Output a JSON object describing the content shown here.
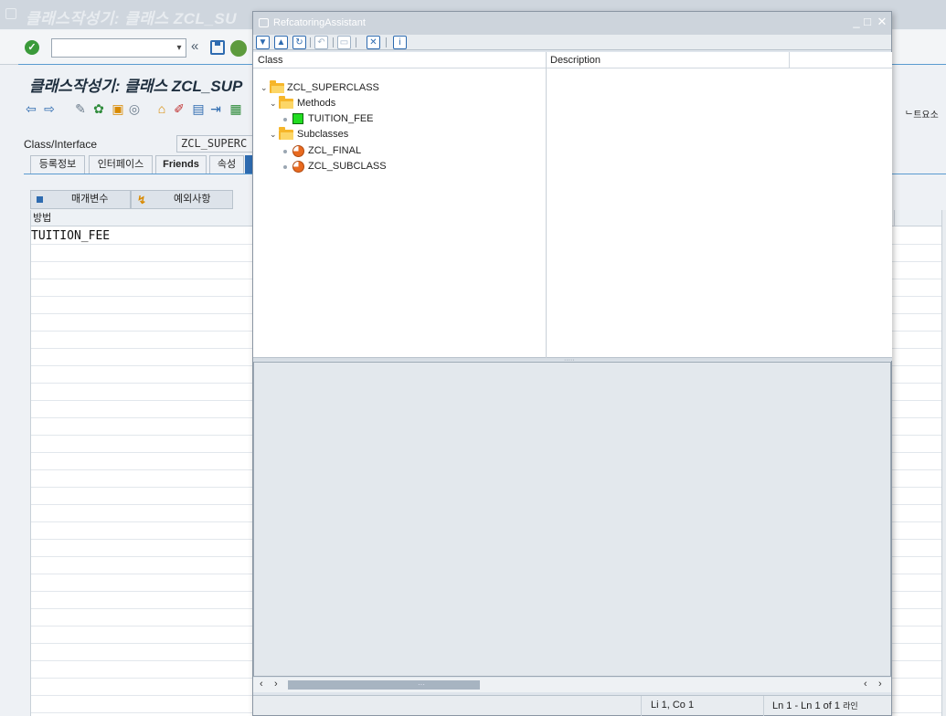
{
  "main": {
    "window_title": "클래스작성기: 클래스 ZCL_SU",
    "screen_title": "클래스작성기: 클래스 ZCL_SUP",
    "elements_label": "ᄂ트요소",
    "class_interface_label": "Class/Interface",
    "class_interface_value": "ZCL_SUPERC",
    "tabs": [
      {
        "label": "등록정보"
      },
      {
        "label": "인터페이스"
      },
      {
        "label": "Friends"
      },
      {
        "label": "속성"
      }
    ],
    "params_label": "매개변수",
    "exceptions_label": "예외사항",
    "grid_header": "방법",
    "rows": [
      "TUITION_FEE"
    ]
  },
  "popup": {
    "title": "RefcatoringAssistant",
    "tree": {
      "col_class": "Class",
      "col_description": "Description",
      "root": "ZCL_SUPERCLASS",
      "methods_folder": "Methods",
      "method": "TUITION_FEE",
      "subclasses_folder": "Subclasses",
      "subclasses": [
        "ZCL_FINAL",
        "ZCL_SUBCLASS"
      ]
    },
    "status": {
      "position": "Li 1, Co 1",
      "lines": "Ln 1 - Ln 1 of 1",
      "lines_suffix": "라인"
    }
  },
  "colors": {
    "accent": "#2e6bb0",
    "folder": "#f6b62a",
    "method_icon": "#22dd22",
    "subclass_icon": "#e86a20"
  },
  "icons": {
    "main_toolbar": [
      "check-icon",
      "collapse-icon",
      "save-icon",
      "back-icon"
    ],
    "popup_toolbar": [
      "expand-all-icon",
      "collapse-all-icon",
      "refresh-icon",
      "undo-icon",
      "save-icon",
      "close-icon",
      "info-icon"
    ]
  }
}
